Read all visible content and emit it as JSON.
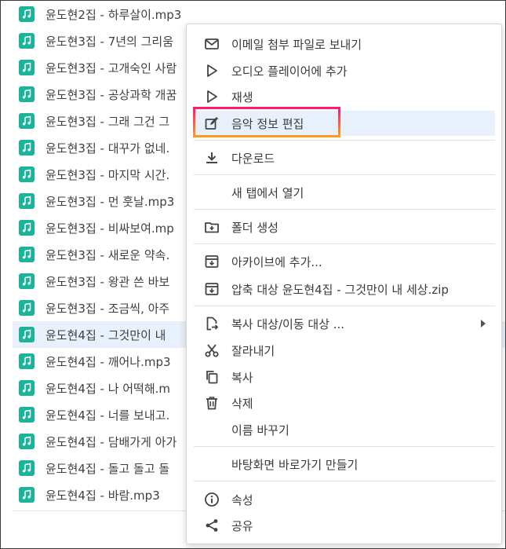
{
  "files": [
    {
      "name": "윤도현2집 - 하루살이.mp3"
    },
    {
      "name": "윤도현3집 - 7년의 그리움"
    },
    {
      "name": "윤도현3집 - 고개숙인 사람"
    },
    {
      "name": "윤도현3집 - 공상과학 개꿈"
    },
    {
      "name": "윤도현3집 - 그래 그건 그"
    },
    {
      "name": "윤도현3집 - 대꾸가 없네."
    },
    {
      "name": "윤도현3집 - 마지막 시간."
    },
    {
      "name": "윤도현3집 - 먼 훗날.mp3"
    },
    {
      "name": "윤도현3집 - 비싸보여.mp"
    },
    {
      "name": "윤도현3집 - 새로운 약속."
    },
    {
      "name": "윤도현3집 - 왕관 쓴 바보"
    },
    {
      "name": "윤도현3집 - 조금씩, 아주"
    },
    {
      "name": "윤도현4집 - 그것만이 내"
    },
    {
      "name": "윤도현4집 - 깨어나.mp3"
    },
    {
      "name": "윤도현4집 - 나 어떡해.m"
    },
    {
      "name": "윤도현4집 - 너를 보내고."
    },
    {
      "name": "윤도현4집 - 담배가게 아가"
    },
    {
      "name": "윤도현4집 - 돌고 돌고 돌"
    },
    {
      "name": "윤도현4집 - 바람.mp3"
    }
  ],
  "selected_file_index": 12,
  "menu": {
    "email": "이메일 첨부 파일로 보내기",
    "add_to_player": "오디오 플레이어에 추가",
    "play": "재생",
    "edit_music_info": "음악 정보 편집",
    "download": "다운로드",
    "open_new_tab": "새 탭에서 열기",
    "create_folder": "폴더 생성",
    "add_to_archive": "아카이브에 추가...",
    "compress_to": "압축 대상 윤도현4집 - 그것만이 내 세상.zip",
    "copy_move_to": "복사 대상/이동 대상 ...",
    "cut": "잘라내기",
    "copy": "복사",
    "delete": "삭제",
    "rename": "이름 바꾸기",
    "create_shortcut": "바탕화면 바로가기 만들기",
    "properties": "속성",
    "share": "공유"
  },
  "colors": {
    "file_icon": "#1bb39a",
    "selected_row": "#e8f0fb",
    "highlight_gradient_top": "#ff1a6e",
    "highlight_gradient_bottom": "#ff9a1a"
  }
}
